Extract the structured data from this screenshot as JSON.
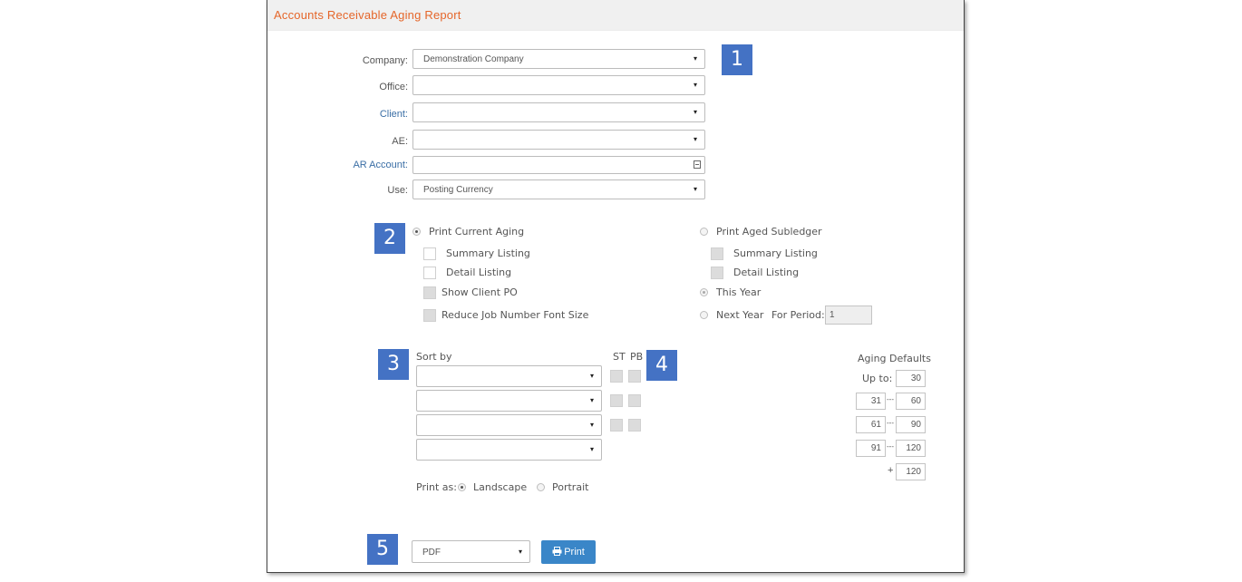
{
  "title": "Accounts Receivable Aging Report",
  "markers": [
    "1",
    "2",
    "3",
    "4",
    "5"
  ],
  "fields": {
    "company": {
      "label": "Company:",
      "value": "Demonstration Company"
    },
    "office": {
      "label": "Office:",
      "value": ""
    },
    "client": {
      "label": "Client:",
      "value": ""
    },
    "ae": {
      "label": "AE:",
      "value": ""
    },
    "ar_account": {
      "label": "AR Account:",
      "value": ""
    },
    "use": {
      "label": "Use:",
      "value": "Posting Currency"
    }
  },
  "caret": "▾",
  "current_aging": {
    "label": "Print Current Aging",
    "selected": true,
    "summary": "Summary Listing",
    "detail": "Detail Listing",
    "show_po": "Show Client PO",
    "reduce_font": "Reduce Job Number Font Size"
  },
  "aged_subledger": {
    "label": "Print Aged Subledger",
    "selected": false,
    "summary": "Summary Listing",
    "detail": "Detail Listing",
    "this_year": "This Year",
    "next_year": "Next Year",
    "for_period_label": "For Period:",
    "for_period_value": "1"
  },
  "sort": {
    "label": "Sort by",
    "st_label": "ST",
    "pb_label": "PB"
  },
  "print_as": {
    "label": "Print as:",
    "landscape": "Landscape",
    "portrait": "Portrait",
    "selected": "Landscape"
  },
  "aging_defaults": {
    "title": "Aging Defaults",
    "up_to_label": "Up to:",
    "up_to": "30",
    "ranges": [
      {
        "from": "31",
        "to": "60"
      },
      {
        "from": "61",
        "to": "90"
      },
      {
        "from": "91",
        "to": "120"
      }
    ],
    "dash": "---",
    "plus_label": "+",
    "plus_value": "120"
  },
  "output": {
    "format": "PDF",
    "print_label": "Print",
    "print_icon": "print-icon"
  },
  "colors": {
    "title": "#e5662a",
    "marker": "#4472c4",
    "button": "#3a86c8",
    "link": "#3a6ea5"
  }
}
